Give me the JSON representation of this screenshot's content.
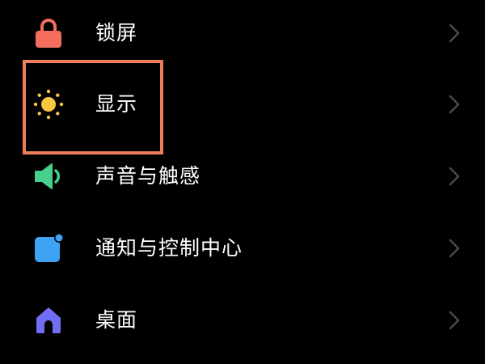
{
  "settings": {
    "items": [
      {
        "label": "锁屏",
        "icon": "lock-icon",
        "color": "#f46d5e"
      },
      {
        "label": "显示",
        "icon": "sun-icon",
        "color": "#f8c63f"
      },
      {
        "label": "声音与触感",
        "icon": "speaker-icon",
        "color": "#47d08a"
      },
      {
        "label": "通知与控制中心",
        "icon": "notification-icon",
        "color": "#3ea3f5"
      },
      {
        "label": "桌面",
        "icon": "home-icon",
        "color": "#6f6ef5"
      }
    ],
    "chevron_icon": "chevron-right-icon",
    "highlight_color": "#f07d5c"
  }
}
